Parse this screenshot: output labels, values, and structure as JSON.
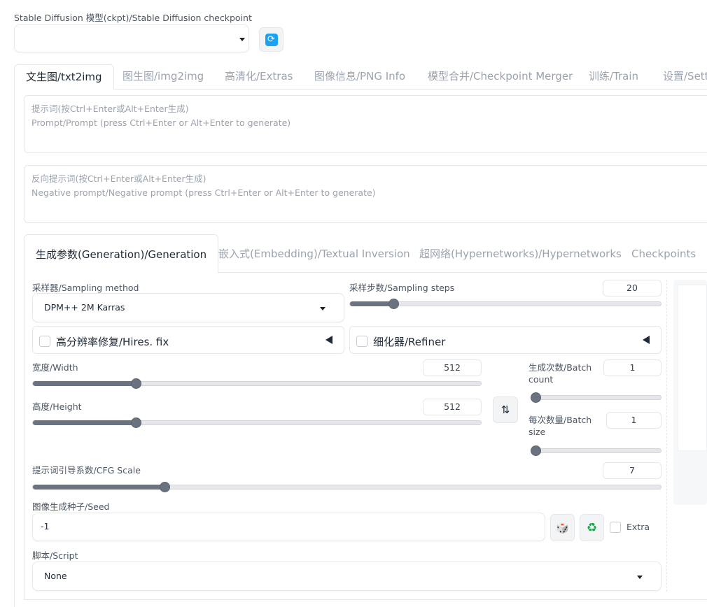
{
  "checkpoint": {
    "label": "Stable Diffusion 模型(ckpt)/Stable Diffusion checkpoint",
    "value": ""
  },
  "top_tabs": [
    {
      "label": "文生图/txt2img",
      "active": true
    },
    {
      "label": "图生图/img2img"
    },
    {
      "label": "高清化/Extras"
    },
    {
      "label": "图像信息/PNG Info"
    },
    {
      "label": "模型合并/Checkpoint Merger"
    },
    {
      "label": "训练/Train"
    },
    {
      "label": "设置/Sett"
    }
  ],
  "prompt": {
    "line1": "提示词(按Ctrl+Enter或Alt+Enter生成)",
    "line2": "Prompt/Prompt (press Ctrl+Enter or Alt+Enter to generate)"
  },
  "negative_prompt": {
    "line1": "反向提示词(按Ctrl+Enter或Alt+Enter生成)",
    "line2": "Negative prompt/Negative prompt (press Ctrl+Enter or Alt+Enter to generate)"
  },
  "sub_tabs": [
    {
      "label": "生成参数(Generation)/Generation",
      "active": true
    },
    {
      "label": "嵌入式(Embedding)/Textual Inversion"
    },
    {
      "label": "超网络(Hypernetworks)/Hypernetworks"
    },
    {
      "label": "Checkpoints"
    }
  ],
  "sampler": {
    "label": "采样器/Sampling method",
    "value": "DPM++ 2M Karras"
  },
  "steps": {
    "label": "采样步数/Sampling steps",
    "value": "20",
    "fraction": 0.14
  },
  "hires": {
    "label": "高分辨率修复/Hires. fix"
  },
  "refiner": {
    "label": "细化器/Refiner"
  },
  "width": {
    "label": "宽度/Width",
    "value": "512",
    "fraction": 0.23
  },
  "height": {
    "label": "高度/Height",
    "value": "512",
    "fraction": 0.23
  },
  "batch_count": {
    "label_1": "生成次数/Batch",
    "label_2": "count",
    "value": "1",
    "fraction": 0.0
  },
  "batch_size": {
    "label_1": "每次数量/Batch",
    "label_2": "size",
    "value": "1",
    "fraction": 0.0
  },
  "cfg": {
    "label": "提示词引导系数/CFG Scale",
    "value": "7",
    "fraction": 0.21
  },
  "seed": {
    "label": "图像生成种子/Seed",
    "value": "-1",
    "extra_label": "Extra"
  },
  "script": {
    "label": "脚本/Script",
    "value": "None"
  },
  "icons": {
    "refresh": "refresh-icon",
    "swap": "swap-dimensions-icon",
    "dice": "dice-icon",
    "recycle": "recycle-icon"
  }
}
